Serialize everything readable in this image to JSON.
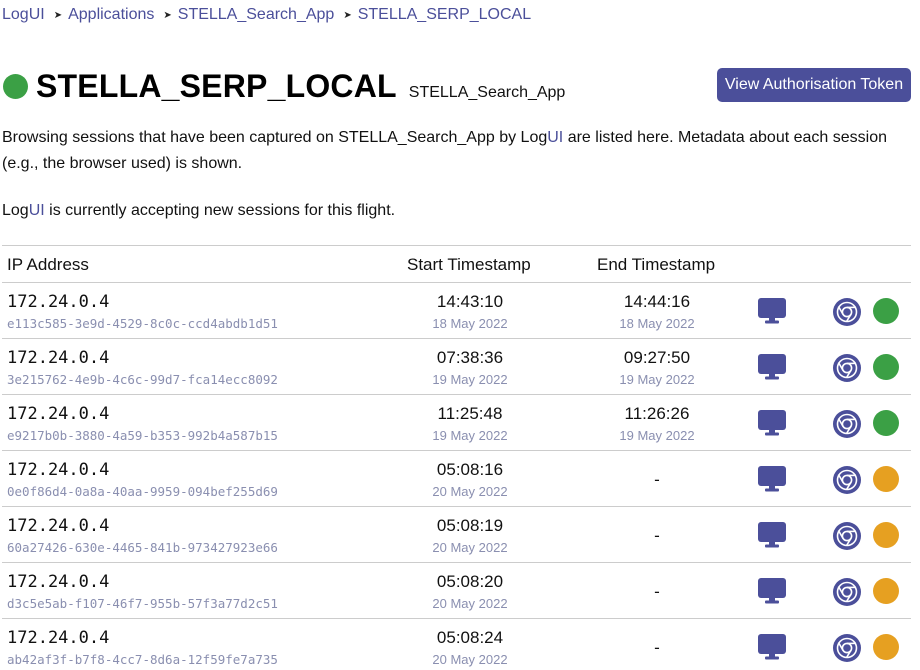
{
  "breadcrumb": [
    {
      "label": "LogUI"
    },
    {
      "label": "Applications"
    },
    {
      "label": "STELLA_Search_App"
    },
    {
      "label": "STELLA_SERP_LOCAL"
    }
  ],
  "header": {
    "title": "STELLA_SERP_LOCAL",
    "subtitle": "STELLA_Search_App",
    "status_color": "#3ba045",
    "token_button": "View Authorisation Token"
  },
  "intro": {
    "part1": "Browsing sessions that have been captured on STELLA_Search_App by Log",
    "part2": "UI",
    "part3": " are listed here. Metadata about each session (e.g., the browser used) is shown."
  },
  "accepting": {
    "part1": "Log",
    "part2": "UI",
    "part3": " is currently accepting new sessions for this flight."
  },
  "table": {
    "headers": {
      "ip": "IP Address",
      "start": "Start Timestamp",
      "end": "End Timestamp"
    },
    "rows": [
      {
        "ip": "172.24.0.4",
        "session_id": "e113c585-3e9d-4529-8c0c-ccd4abdb1d51",
        "start_time": "14:43:10",
        "start_date": "18 May 2022",
        "end_time": "14:44:16",
        "end_date": "18 May 2022",
        "status": "complete"
      },
      {
        "ip": "172.24.0.4",
        "session_id": "3e215762-4e9b-4c6c-99d7-fca14ecc8092",
        "start_time": "07:38:36",
        "start_date": "19 May 2022",
        "end_time": "09:27:50",
        "end_date": "19 May 2022",
        "status": "complete"
      },
      {
        "ip": "172.24.0.4",
        "session_id": "e9217b0b-3880-4a59-b353-992b4a587b15",
        "start_time": "11:25:48",
        "start_date": "19 May 2022",
        "end_time": "11:26:26",
        "end_date": "19 May 2022",
        "status": "complete"
      },
      {
        "ip": "172.24.0.4",
        "session_id": "0e0f86d4-0a8a-40aa-9959-094bef255d69",
        "start_time": "05:08:16",
        "start_date": "20 May 2022",
        "end_time": "-",
        "end_date": "",
        "status": "active"
      },
      {
        "ip": "172.24.0.4",
        "session_id": "60a27426-630e-4465-841b-973427923e66",
        "start_time": "05:08:19",
        "start_date": "20 May 2022",
        "end_time": "-",
        "end_date": "",
        "status": "active"
      },
      {
        "ip": "172.24.0.4",
        "session_id": "d3c5e5ab-f107-46f7-955b-57f3a77d2c51",
        "start_time": "05:08:20",
        "start_date": "20 May 2022",
        "end_time": "-",
        "end_date": "",
        "status": "active"
      },
      {
        "ip": "172.24.0.4",
        "session_id": "ab42af3f-b7f8-4cc7-8d6a-12f59fe7a735",
        "start_time": "05:08:24",
        "start_date": "20 May 2022",
        "end_time": "-",
        "end_date": "",
        "status": "active"
      }
    ]
  },
  "colors": {
    "accent": "#4b4f9a",
    "complete": "#3ba045",
    "active": "#e6a021",
    "muted": "#8a8fb0"
  },
  "icons": {
    "device": "desktop-monitor-icon",
    "browser": "chrome-icon"
  }
}
